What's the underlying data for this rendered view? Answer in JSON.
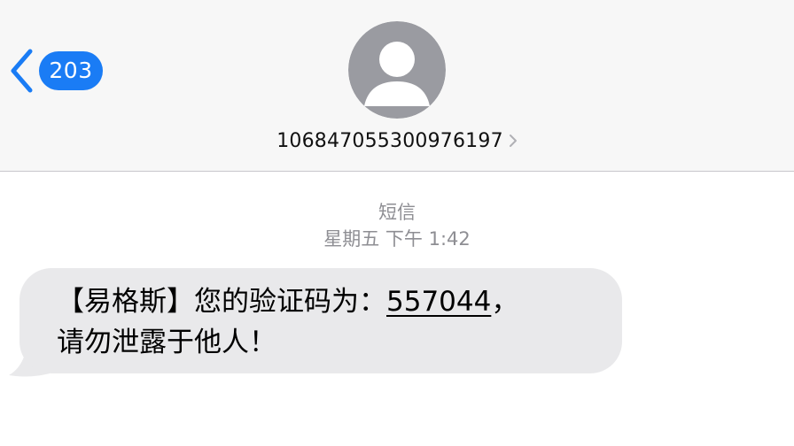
{
  "header": {
    "unread_count": "203",
    "contact_number": "106847055300976197"
  },
  "thread": {
    "service_label": "短信",
    "timestamp": "星期五 下午 1:42"
  },
  "message": {
    "prefix": "【易格斯】您的验证码为：",
    "code": "557044",
    "code_suffix": "，",
    "line2": "请勿泄露于他人！"
  },
  "colors": {
    "accent": "#1a7cf5",
    "header_bg": "#f7f7f7",
    "bubble_bg": "#e9e9eb",
    "secondary_text": "#8e8e93",
    "avatar_bg": "#9a9ba1"
  },
  "icons": {
    "back": "chevron-left-icon",
    "avatar": "person-silhouette-icon",
    "contact_details": "chevron-right-icon"
  }
}
